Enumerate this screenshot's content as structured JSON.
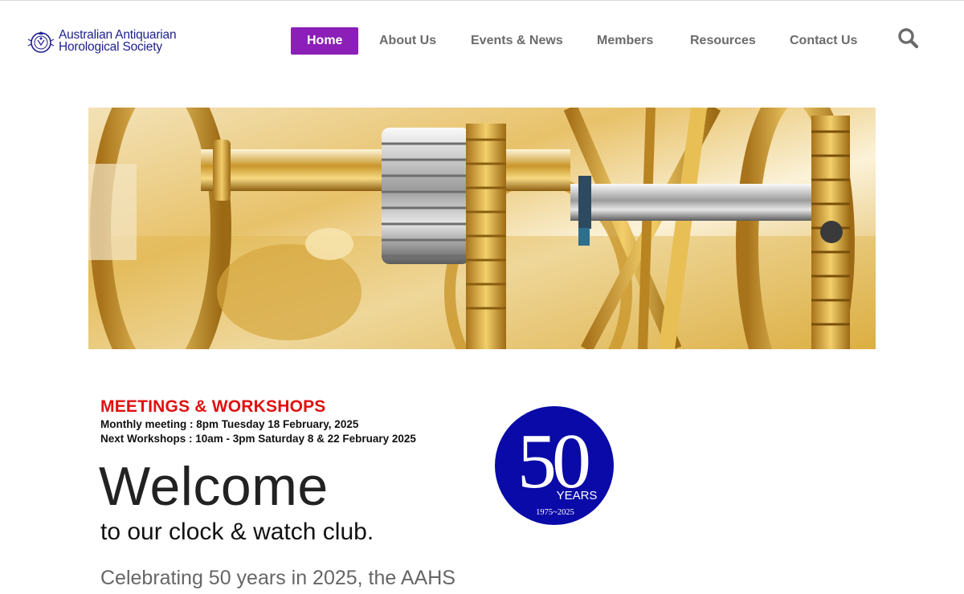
{
  "header": {
    "logo": {
      "line1": "Australian Antiquarian",
      "line2": "Horological Society",
      "emblem_icon": "society-crest-icon"
    },
    "nav": [
      {
        "label": "Home",
        "active": true
      },
      {
        "label": "About Us",
        "active": false
      },
      {
        "label": "Events & News",
        "active": false
      },
      {
        "label": "Members",
        "active": false
      },
      {
        "label": "Resources",
        "active": false
      },
      {
        "label": "Contact Us",
        "active": false
      }
    ],
    "search_icon": "search-icon"
  },
  "hero": {
    "image": "brass-clock-movement-gears"
  },
  "meetings": {
    "title": "MEETINGS & WORKSHOPS",
    "monthly": "Monthly meeting : 8pm Tuesday 18 February, 2025",
    "workshops": "Next Workshops : 10am - 3pm Saturday 8 & 22 February 2025"
  },
  "welcome": {
    "heading": "Welcome",
    "subheading": "to our clock & watch club.",
    "intro": "Celebrating 50 years in 2025, the AAHS"
  },
  "badge": {
    "number": "50",
    "label": "YEARS",
    "range": "1975~2025"
  },
  "colors": {
    "brand_blue": "#1d1f8f",
    "nav_active": "#8b1fb8",
    "alert_red": "#e01010",
    "badge_blue": "#0a0aa8",
    "gold": "#d4a62a"
  }
}
